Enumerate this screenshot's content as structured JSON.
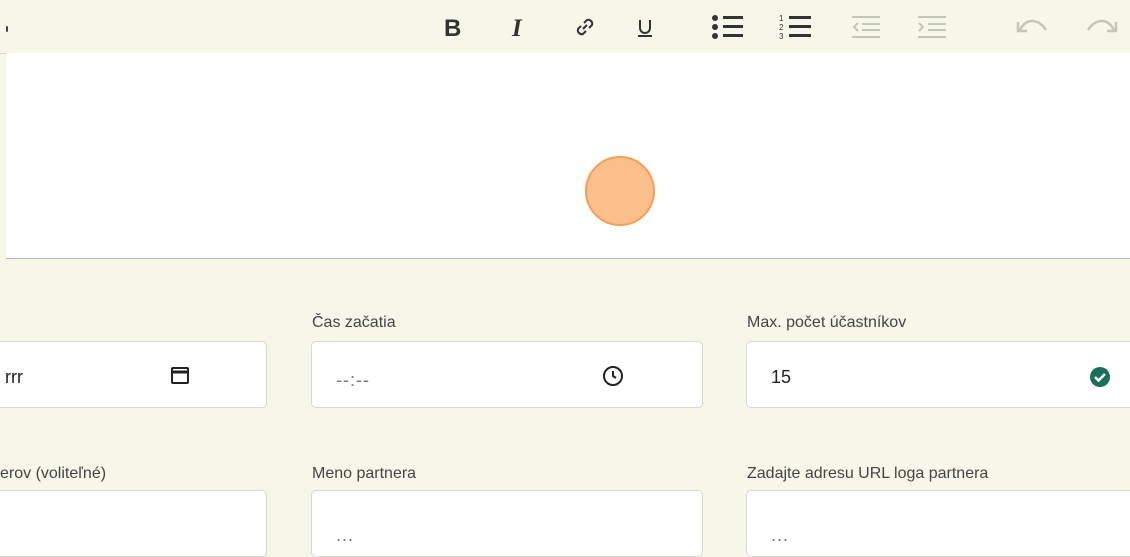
{
  "toolbar": {
    "buttons": [
      {
        "name": "bold",
        "icon": "bold-icon"
      },
      {
        "name": "italic",
        "icon": "italic-icon"
      },
      {
        "name": "link",
        "icon": "link-icon"
      },
      {
        "name": "underline",
        "icon": "underline-icon"
      },
      {
        "name": "bullet-list",
        "icon": "bullet-list-icon"
      },
      {
        "name": "numbered-list",
        "icon": "numbered-list-icon"
      },
      {
        "name": "outdent",
        "icon": "outdent-icon",
        "disabled": true
      },
      {
        "name": "indent",
        "icon": "indent-icon",
        "disabled": true
      },
      {
        "name": "undo",
        "icon": "undo-icon",
        "disabled": true
      },
      {
        "name": "redo",
        "icon": "redo-icon",
        "disabled": true
      }
    ]
  },
  "form": {
    "row1": {
      "date_value": "rrr",
      "time_label": "Čas začatia",
      "time_placeholder": "--:--",
      "max_label": "Max. počet účastníkov",
      "max_value": "15"
    },
    "row2": {
      "partners_label": "erov (voliteľné)",
      "partner_name_label": "Meno partnera",
      "partner_name_placeholder": "...",
      "partner_logo_label": "Zadajte adresu URL loga partnera",
      "partner_logo_placeholder": "..."
    }
  },
  "colors": {
    "background": "#f6f7e8",
    "editor": "#ffffff",
    "valid_check": "#1b6e5a",
    "cursor_highlight": "#f8b47a"
  }
}
